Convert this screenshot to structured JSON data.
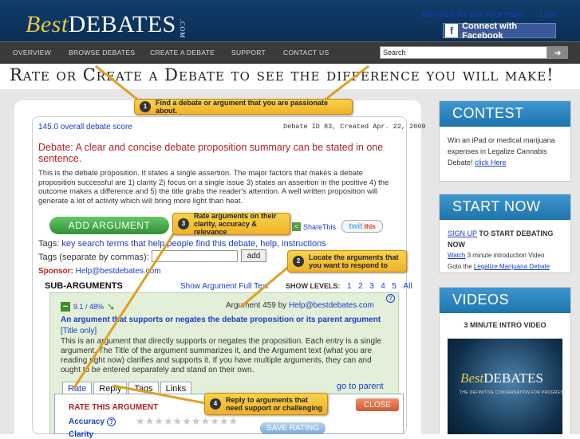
{
  "header": {
    "logo_best": "Best",
    "logo_debates": "DEBATES",
    "logo_com": ".COM",
    "join_link": "Join and make your voice heard",
    "login_link": "Login",
    "fb_button": "Connect with Facebook"
  },
  "nav": {
    "items": [
      "OVERVIEW",
      "BROWSE DEBATES",
      "CREATE A DEBATE",
      "SUPPORT",
      "CONTACT US"
    ],
    "search_placeholder": "Search"
  },
  "tagline": "Rate or Create a Debate to see the difference you will make!",
  "debate": {
    "score": "145.0 overall debate score",
    "id_line": "Debate ID 83, Created Apr. 22, 2009",
    "title": "Debate: A clear and concise debate proposition summary can be stated in one sentence.",
    "body": "This is the debate proposition. It states a single assertion. The major factors that makes a debate proposition successful are 1) clarity 2) focus on a single issue 3) states an assertion in the positive 4) the outcome makes a difference and 5) the title grabs the reader's attention. A well written proposition will generate a lot of activity which will bring more light than heat.",
    "add_argument": "ADD ARGUMENT",
    "share": "ShareThis",
    "twit": "twit",
    "twit_this": "this",
    "tags_label": "Tags:",
    "tags_values": "key search terms that help people find this debate, help, instructions",
    "tags_sep_label": "Tags (separate by commas):",
    "tags_add": "add",
    "sponsor_label": "Sponsor:",
    "sponsor_value": "Help@bestdebates.com"
  },
  "subargs": {
    "heading": "SUB-ARGUMENTS",
    "show_full": "Show Argument Full Text",
    "show_levels": "SHOW LEVELS:",
    "levels": [
      "1",
      "2",
      "3",
      "4",
      "5",
      "All"
    ],
    "score": "9.1 / 48%",
    "arg_id_prefix": "Argument 459 by",
    "arg_author": "Help@bestdebates.com",
    "arg_title": "An argument that supports or negates the debate proposition or its parent argument",
    "arg_title_only": "[Title only]",
    "arg_body": "This is an argument that directly supports or negates the proposition. Each entry is a single argument. The Title of the argument summarizes it, and the Argument text (what you are reading right now) clarifies and supports it. If you have multiple arguments, they can and ought to be entered separately and stand on their own.",
    "tabs": [
      "Rate",
      "Reply",
      "Tags",
      "Links"
    ],
    "goto_parent": "go to parent",
    "rate_title": "RATE THIS ARGUMENT",
    "close": "CLOSE",
    "accuracy": "Accuracy",
    "clarity": "Clarity",
    "save_rating": "SAVE RATING"
  },
  "callouts": {
    "c1_num": "1",
    "c1": "Find a debate or argument that you are passionate about.",
    "c2_num": "2",
    "c2": "Locate the arguments that you want to respond to",
    "c3_num": "3",
    "c3": "Rate arguments on their clarity, accuracy & relevance",
    "c4_num": "4",
    "c4": "Reply to arguments that need support or challenging"
  },
  "sidebar": {
    "contest_head": "CONTEST",
    "contest_text": "Win an iPad or medical marijuana expenses in Legalize Cannabis Debate!",
    "contest_link": "click Here",
    "start_head": "START NOW",
    "signup_link": "SIGN UP",
    "signup_rest": "TO START DEBATING NOW",
    "watch_link": "Watch",
    "watch_rest": "3 minute introduction Video",
    "goto_text": "Goto the",
    "goto_link": "Legalize Marijuana Debate",
    "videos_head": "VIDEOS",
    "video_title": "3 MINUTE INTRO VIDEO",
    "video_logo_best": "Best",
    "video_logo_debates": "DEBATES",
    "video_sub": "THE DEFINITIVE CONVERSATION FOR PROGRESS"
  },
  "colors": {
    "header": "#0f3d6a",
    "accent_red": "#b22222",
    "link": "#1a3cc8",
    "callout": "#f7d24b",
    "side_head": "#2a86c0"
  }
}
